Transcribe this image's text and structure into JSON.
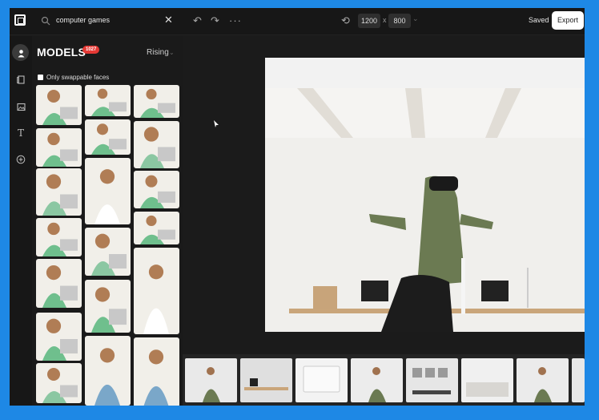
{
  "search": {
    "query": "computer games"
  },
  "toolbar": {
    "width": "1200",
    "separator": "x",
    "height": "800",
    "saved_label": "Saved",
    "export_label": "Export"
  },
  "panel": {
    "title": "MODELS",
    "badge_count": "1027",
    "sort_label": "Rising",
    "swappable_label": "Only swappable faces"
  },
  "colors": {
    "accent_badge": "#e53935",
    "background": "#1b1b1b",
    "window_border": "#1e88e5"
  },
  "icons": {
    "rail": [
      "user-icon",
      "templates-icon",
      "image-icon",
      "text-icon",
      "add-icon"
    ],
    "toolbar": [
      "undo-icon",
      "redo-icon",
      "more-icon",
      "rotate-icon"
    ]
  }
}
